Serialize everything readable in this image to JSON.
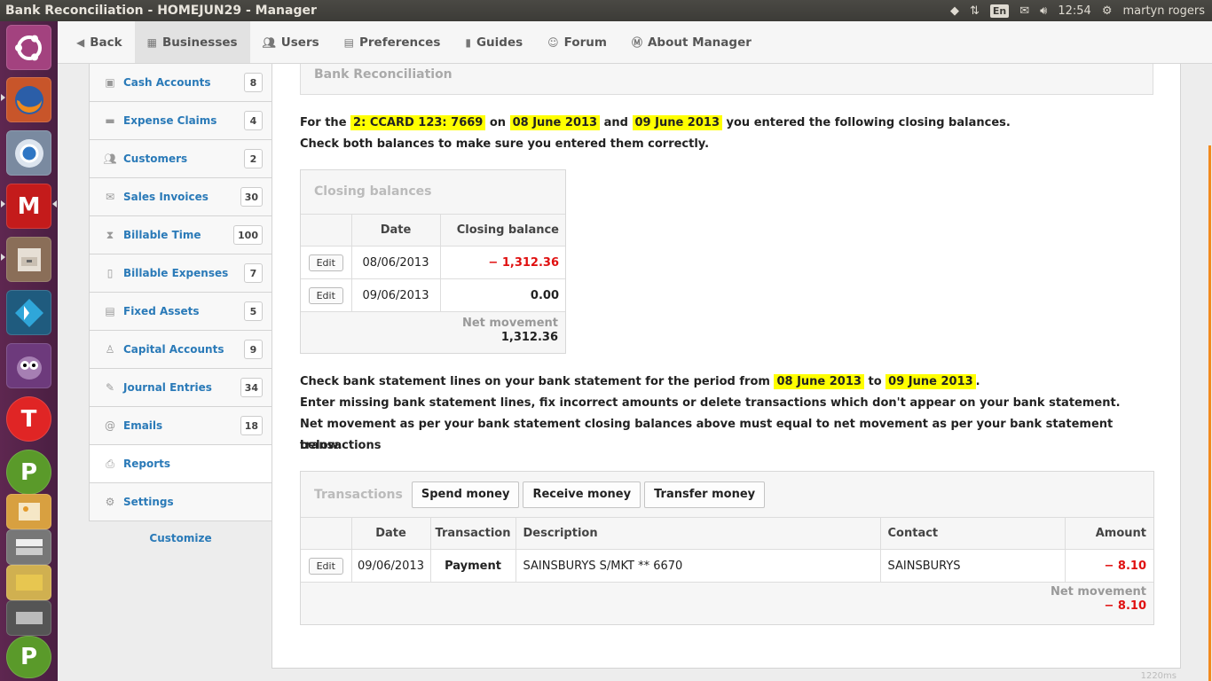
{
  "window": {
    "title": "Bank Reconciliation - HOMEJUN29 - Manager"
  },
  "tray": {
    "lang": "En",
    "time": "12:54",
    "user": "martyn rogers"
  },
  "nav": {
    "back": "Back",
    "businesses": "Businesses",
    "users": "Users",
    "preferences": "Preferences",
    "guides": "Guides",
    "forum": "Forum",
    "about": "About Manager"
  },
  "sidebar": {
    "items": [
      {
        "label": "Cash Accounts",
        "count": "8"
      },
      {
        "label": "Expense Claims",
        "count": "4"
      },
      {
        "label": "Customers",
        "count": "2"
      },
      {
        "label": "Sales Invoices",
        "count": "30"
      },
      {
        "label": "Billable Time",
        "count": "100"
      },
      {
        "label": "Billable Expenses",
        "count": "7"
      },
      {
        "label": "Fixed Assets",
        "count": "5"
      },
      {
        "label": "Capital Accounts",
        "count": "9"
      },
      {
        "label": "Journal Entries",
        "count": "34"
      },
      {
        "label": "Emails",
        "count": "18"
      },
      {
        "label": "Reports",
        "count": ""
      },
      {
        "label": "Settings",
        "count": ""
      }
    ],
    "customize": "Customize"
  },
  "main": {
    "heading": "Bank Reconciliation",
    "intro": {
      "p1": "For the",
      "account": "2: CCARD 123: 7669",
      "on": "on",
      "date1": "08 June 2013",
      "and": "and",
      "date2": "09 June 2013",
      "p2": "you entered the following closing balances.",
      "line2": "Check both balances to make sure you entered them correctly."
    },
    "closing": {
      "title": "Closing balances",
      "col_date": "Date",
      "col_balance": "Closing balance",
      "rows": [
        {
          "edit": "Edit",
          "date": "08/06/2013",
          "balance": "− 1,312.36"
        },
        {
          "edit": "Edit",
          "date": "09/06/2013",
          "balance": "0.00"
        }
      ],
      "net_label": "Net movement",
      "net_value": "1,312.36"
    },
    "check": {
      "p1": "Check bank statement lines on your bank statement for the period from",
      "from": "08 June 2013",
      "to_word": "to",
      "to": "09 June 2013",
      "dot": ".",
      "line2": "Enter missing bank statement lines, fix incorrect amounts or delete transactions which don't appear on your bank statement.",
      "line3": "Net movement as per your bank statement closing balances above must equal to net movement as per your bank statement transactions",
      "line4": "below."
    },
    "transactions": {
      "title": "Transactions",
      "btn_spend": "Spend money",
      "btn_receive": "Receive money",
      "btn_transfer": "Transfer money",
      "col_date": "Date",
      "col_transaction": "Transaction",
      "col_description": "Description",
      "col_contact": "Contact",
      "col_amount": "Amount",
      "row": {
        "edit": "Edit",
        "date": "09/06/2013",
        "transaction": "Payment",
        "description": "SAINSBURYS S/MKT ** 6670",
        "contact": "SAINSBURYS",
        "amount": "− 8.10"
      },
      "net_label": "Net movement",
      "net_value": "− 8.10"
    }
  },
  "footer_size": "1220ms"
}
